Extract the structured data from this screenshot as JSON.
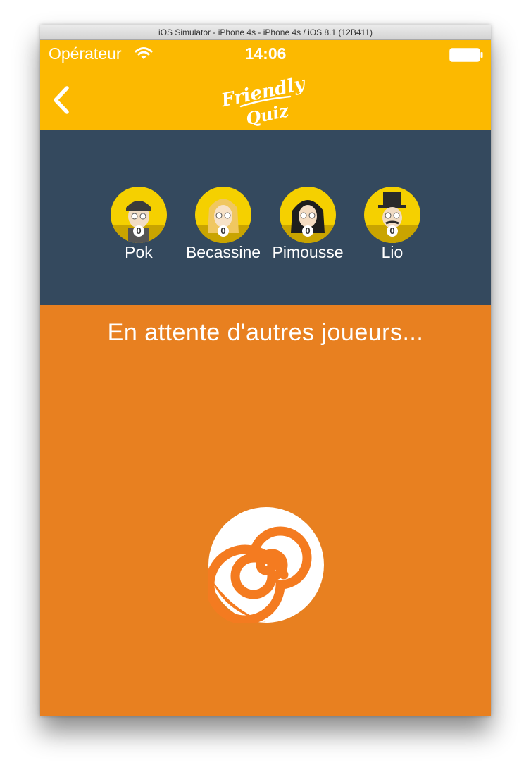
{
  "window": {
    "title": "iOS Simulator - iPhone 4s - iPhone 4s / iOS 8.1 (12B411)"
  },
  "status_bar": {
    "carrier": "Opérateur",
    "time": "14:06",
    "icons": [
      "wifi-icon",
      "battery-icon"
    ]
  },
  "nav": {
    "back_icon": "chevron-left-icon",
    "logo_line1": "Friendly",
    "logo_line2": "Quiz"
  },
  "players": [
    {
      "name": "Pok",
      "score": "0"
    },
    {
      "name": "Becassine",
      "score": "0"
    },
    {
      "name": "Pimousse",
      "score": "0"
    },
    {
      "name": "Lio",
      "score": "0"
    }
  ],
  "main": {
    "waiting_message": "En attente d'autres joueurs...",
    "spinner_icon": "swirl-spinner-icon"
  },
  "colors": {
    "nav_yellow": "#fcb900",
    "panel_navy": "#34495e",
    "content_orange": "#e88020",
    "avatar_yellow": "#f5d000"
  }
}
